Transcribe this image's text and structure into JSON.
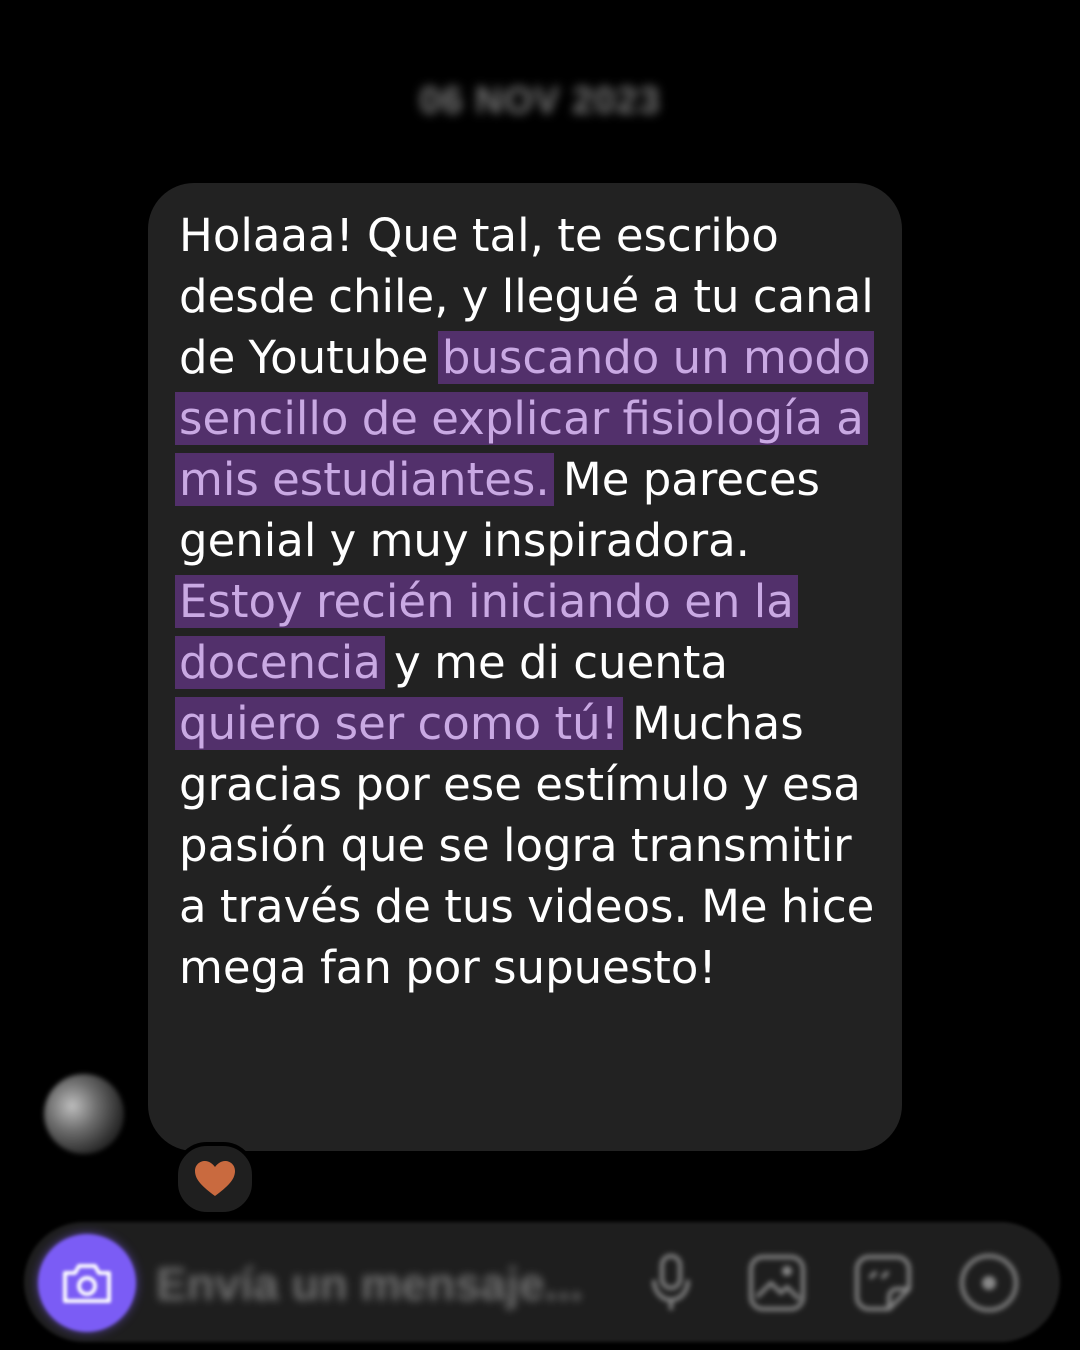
{
  "conversation": {
    "date_label": "06 NOV 2023"
  },
  "message": {
    "segments": [
      {
        "text": "Holaaa! Que tal, te escribo desde chile, y llegué a tu canal de Youtube ",
        "highlight": false
      },
      {
        "text": "buscando un modo sencillo de explicar fisiología a mis estudiantes.",
        "highlight": true
      },
      {
        "text": " Me pareces genial y muy inspiradora. ",
        "highlight": false
      },
      {
        "text": "Estoy recién iniciando en la docencia",
        "highlight": true
      },
      {
        "text": " y me di cuenta ",
        "highlight": false
      },
      {
        "text": "quiero ser como tú!",
        "highlight": true
      },
      {
        "text": " Muchas gracias por ese estímulo y esa pasión que se logra transmitir a través de tus videos. Me hice mega fan por supuesto!",
        "highlight": false
      }
    ],
    "reaction": "heart-icon"
  },
  "composer": {
    "placeholder": "Envía un mensaje...",
    "value": ""
  },
  "icons": {
    "camera_button": "camera-icon",
    "mic": "microphone-icon",
    "gallery": "image-gallery-icon",
    "sticker": "sticker-icon",
    "more": "plus-circle-icon"
  },
  "colors": {
    "background": "#000000",
    "bubble": "#222222",
    "highlight_bg": "#52306b",
    "highlight_text": "#c9a9e3",
    "accent": "#7b5cf5",
    "reaction_heart": "#c96a3f"
  }
}
